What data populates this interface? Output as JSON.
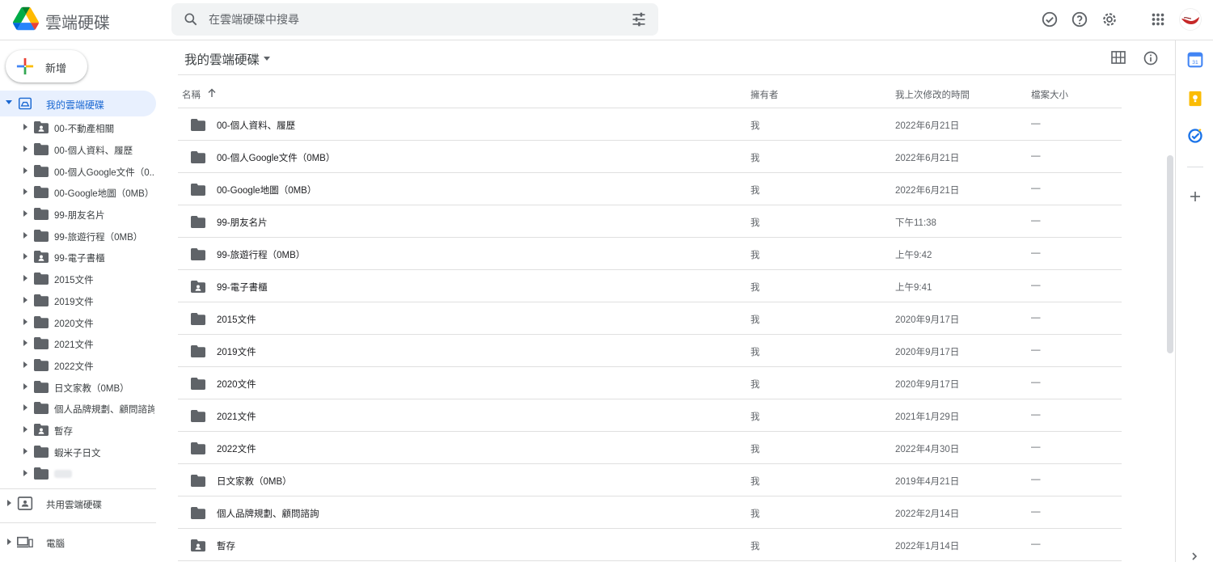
{
  "header": {
    "app_title": "雲端硬碟",
    "search_placeholder": "在雲端硬碟中搜尋"
  },
  "sidebar": {
    "new_label": "新增",
    "my_drive_label": "我的雲端硬碟",
    "tree": [
      {
        "label": "00-不動產相關",
        "icon": "shared-folder-icon"
      },
      {
        "label": "00-個人資料、履歷",
        "icon": "folder-icon"
      },
      {
        "label": "00-個人Google文件（0...",
        "icon": "folder-icon"
      },
      {
        "label": "00-Google地圖（0MB）",
        "icon": "folder-icon"
      },
      {
        "label": "99-朋友名片",
        "icon": "folder-icon"
      },
      {
        "label": "99-旅遊行程（0MB）",
        "icon": "folder-icon"
      },
      {
        "label": "99-電子書櫃",
        "icon": "shared-folder-icon"
      },
      {
        "label": "2015文件",
        "icon": "folder-icon"
      },
      {
        "label": "2019文件",
        "icon": "folder-icon"
      },
      {
        "label": "2020文件",
        "icon": "folder-icon"
      },
      {
        "label": "2021文件",
        "icon": "folder-icon"
      },
      {
        "label": "2022文件",
        "icon": "folder-icon"
      },
      {
        "label": "日文家教（0MB）",
        "icon": "folder-icon"
      },
      {
        "label": "個人品牌規劃、顧問諮詢",
        "icon": "folder-icon"
      },
      {
        "label": "暫存",
        "icon": "shared-folder-icon"
      },
      {
        "label": "蝦米子日文",
        "icon": "folder-icon"
      }
    ],
    "shared_drives_label": "共用雲端硬碟",
    "computers_label": "電腦"
  },
  "main": {
    "title": "我的雲端硬碟",
    "columns": {
      "name": "名稱",
      "owner": "擁有者",
      "modified": "我上次修改的時間",
      "size": "檔案大小"
    },
    "rows": [
      {
        "name": "00-個人資料、履歷",
        "owner": "我",
        "modified": "2022年6月21日",
        "size": "—",
        "icon": "folder-icon"
      },
      {
        "name": "00-個人Google文件（0MB）",
        "owner": "我",
        "modified": "2022年6月21日",
        "size": "—",
        "icon": "folder-icon"
      },
      {
        "name": "00-Google地圖（0MB）",
        "owner": "我",
        "modified": "2022年6月21日",
        "size": "—",
        "icon": "folder-icon"
      },
      {
        "name": "99-朋友名片",
        "owner": "我",
        "modified": "下午11:38",
        "size": "—",
        "icon": "folder-icon"
      },
      {
        "name": "99-旅遊行程（0MB）",
        "owner": "我",
        "modified": "上午9:42",
        "size": "—",
        "icon": "folder-icon"
      },
      {
        "name": "99-電子書櫃",
        "owner": "我",
        "modified": "上午9:41",
        "size": "—",
        "icon": "shared-folder-icon"
      },
      {
        "name": "2015文件",
        "owner": "我",
        "modified": "2020年9月17日",
        "size": "—",
        "icon": "folder-icon"
      },
      {
        "name": "2019文件",
        "owner": "我",
        "modified": "2020年9月17日",
        "size": "—",
        "icon": "folder-icon"
      },
      {
        "name": "2020文件",
        "owner": "我",
        "modified": "2020年9月17日",
        "size": "—",
        "icon": "folder-icon"
      },
      {
        "name": "2021文件",
        "owner": "我",
        "modified": "2021年1月29日",
        "size": "—",
        "icon": "folder-icon"
      },
      {
        "name": "2022文件",
        "owner": "我",
        "modified": "2022年4月30日",
        "size": "—",
        "icon": "folder-icon"
      },
      {
        "name": "日文家教（0MB）",
        "owner": "我",
        "modified": "2019年4月21日",
        "size": "—",
        "icon": "folder-icon"
      },
      {
        "name": "個人品牌規劃、顧問諮詢",
        "owner": "我",
        "modified": "2022年2月14日",
        "size": "—",
        "icon": "folder-icon"
      },
      {
        "name": "暫存",
        "owner": "我",
        "modified": "2022年1月14日",
        "size": "—",
        "icon": "shared-folder-icon"
      }
    ]
  },
  "colors": {
    "accent": "#1967d2",
    "selected_bg": "#e8f0fe",
    "folder": "#5f6368"
  }
}
